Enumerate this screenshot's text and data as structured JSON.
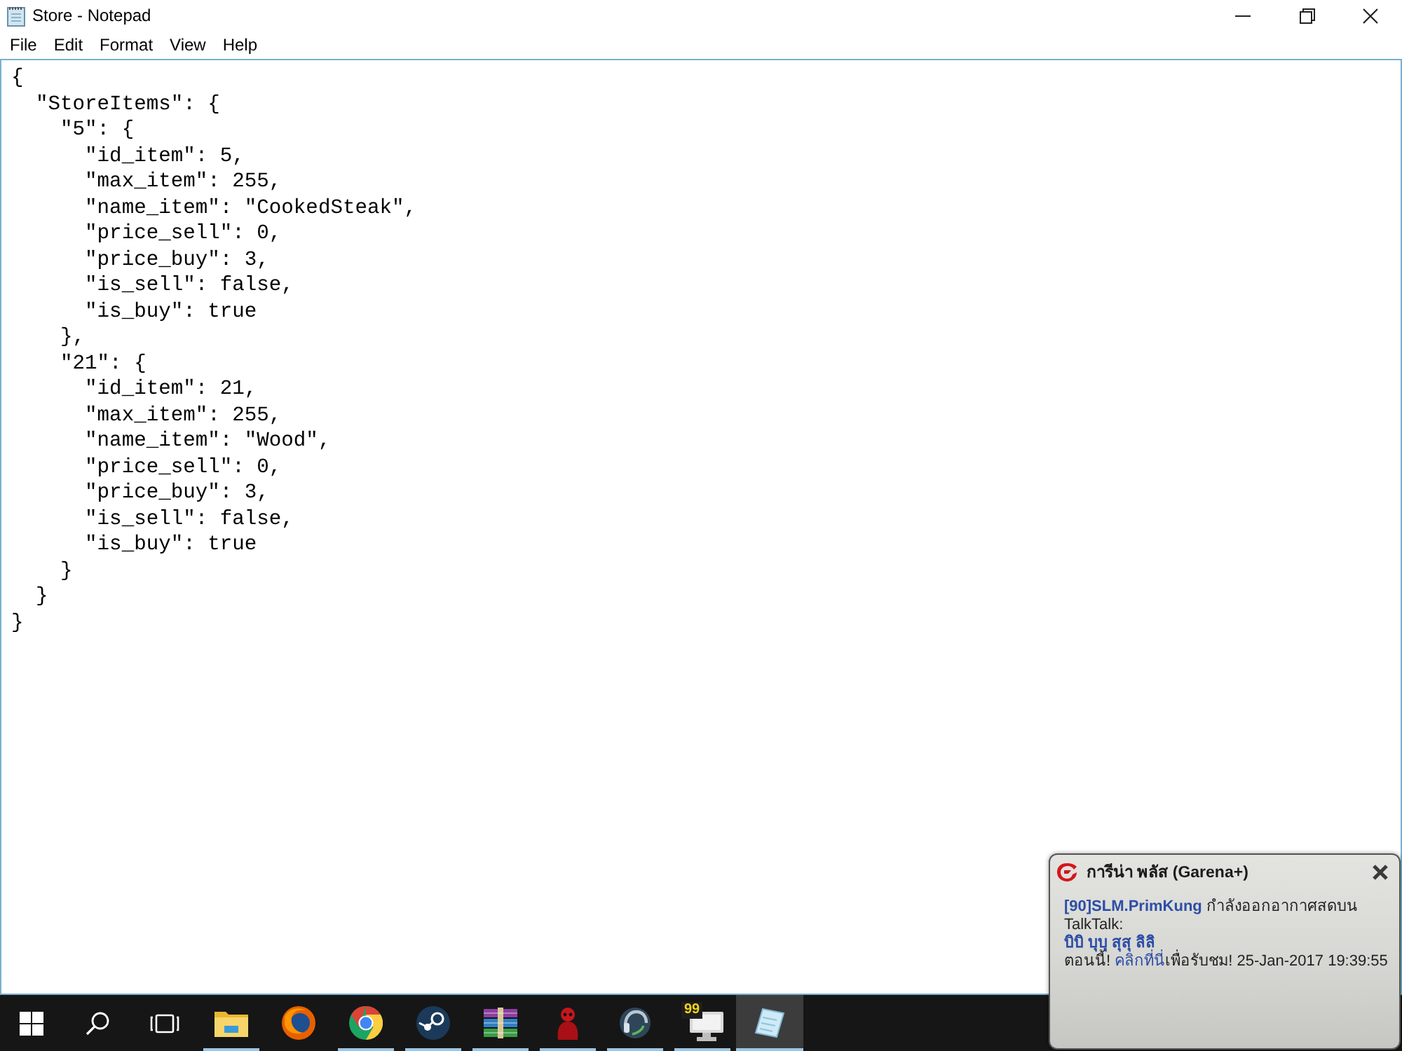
{
  "window": {
    "title": "Store - Notepad"
  },
  "menu": [
    "File",
    "Edit",
    "Format",
    "View",
    "Help"
  ],
  "editor": {
    "lines": [
      "{",
      "  \"StoreItems\": {",
      "    \"5\": {",
      "      \"id_item\": 5,",
      "      \"max_item\": 255,",
      "      \"name_item\": \"CookedSteak\",",
      "      \"price_sell\": 0,",
      "      \"price_buy\": 3,",
      "      \"is_sell\": false,",
      "      \"is_buy\": true",
      "    },",
      "    \"21\": {",
      "      \"id_item\": 21,",
      "      \"max_item\": 255,",
      "      \"name_item\": \"Wood\",",
      "      \"price_sell\": 0,",
      "      \"price_buy\": 3,",
      "      \"is_sell\": false,",
      "      \"is_buy\": true",
      "    }",
      "  }",
      "}"
    ]
  },
  "taskbar": {
    "items": [
      {
        "kind": "start",
        "running": false,
        "selected": false
      },
      {
        "kind": "search",
        "running": false,
        "selected": false
      },
      {
        "kind": "taskview",
        "running": false,
        "selected": false
      },
      {
        "kind": "explorer",
        "running": true,
        "selected": false
      },
      {
        "kind": "firefox",
        "running": false,
        "selected": false
      },
      {
        "kind": "chrome",
        "running": true,
        "selected": false
      },
      {
        "kind": "steam",
        "running": true,
        "selected": false
      },
      {
        "kind": "winrar",
        "running": true,
        "selected": false
      },
      {
        "kind": "game",
        "running": true,
        "selected": false
      },
      {
        "kind": "teamspeak",
        "running": true,
        "selected": false
      },
      {
        "kind": "monitor",
        "badge": "99",
        "running": true,
        "selected": false
      },
      {
        "kind": "notepad",
        "running": true,
        "selected": true
      }
    ]
  },
  "notification": {
    "title": "การีน่า พลัส (Garena+)",
    "message": "**[90]SLM.PrimKung** กำลังออกอากาศสดบน TalkTalk:",
    "channel": "บิบิ บุบุ สุสุ ลิลิ",
    "call_to_action": {
      "before": "ตอนนี้!",
      "link": "คลิกที่นี่",
      "after": "เพื่อรับชม!"
    },
    "timestamp": "25-Jan-2017 19:39:55"
  }
}
